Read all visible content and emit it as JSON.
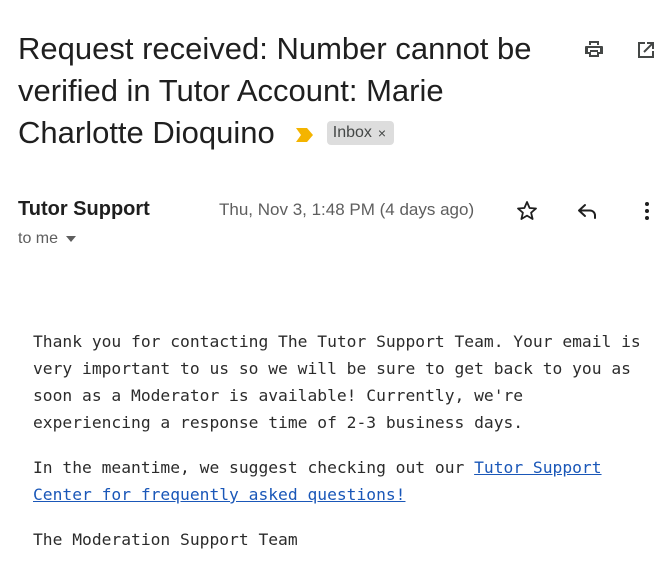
{
  "email": {
    "subject": "Request received: Number cannot be verified in Tutor Account: Marie Charlotte Dioquino",
    "label": "Inbox",
    "label_remove": "×",
    "sender": "Tutor Support",
    "date": "Thu, Nov 3, 1:48 PM (4 days ago)",
    "recipient": "to me",
    "body": {
      "para1": "Thank you for contacting The Tutor Support Team. Your email is very important to us so we will be sure to get back to you as soon as a Moderator is available! Currently, we're experiencing a response time of 2-3 business days.",
      "para2_prefix": "In the meantime, we suggest checking out our ",
      "para2_link": "Tutor Support Center for frequently asked questions!",
      "signature": "The Moderation Support Team"
    }
  },
  "icons": {
    "print": "print-icon",
    "open_new_window": "open-in-new-window-icon",
    "importance": "importance-marker-icon",
    "star": "star-icon",
    "reply": "reply-icon",
    "more": "more-vertical-icon",
    "recipient_details": "chevron-down-icon"
  },
  "colors": {
    "importance_marker": "#f4b400",
    "link": "#1a57b8",
    "chip_bg": "#dddddd"
  }
}
